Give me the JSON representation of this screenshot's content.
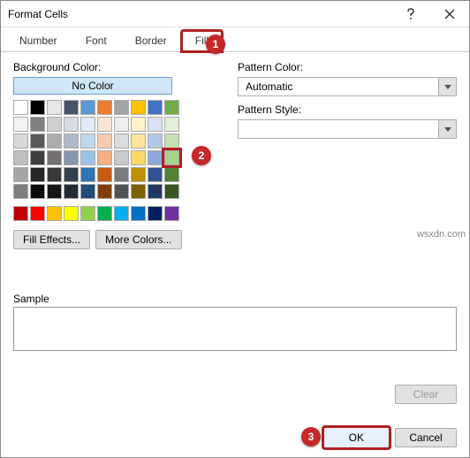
{
  "title": "Format Cells",
  "tabs": {
    "number": "Number",
    "font": "Font",
    "border": "Border",
    "fill": "Fill"
  },
  "left": {
    "bg_label": "Background Color:",
    "no_color": "No Color",
    "fill_effects": "Fill Effects...",
    "more_colors": "More Colors..."
  },
  "right": {
    "pattern_color_label": "Pattern Color:",
    "pattern_color_value": "Automatic",
    "pattern_style_label": "Pattern Style:",
    "pattern_style_value": ""
  },
  "sample_label": "Sample",
  "buttons": {
    "clear": "Clear",
    "ok": "OK",
    "cancel": "Cancel"
  },
  "callouts": {
    "c1": "1",
    "c2": "2",
    "c3": "3"
  },
  "watermark": "wsxdn.com",
  "theme_rows": [
    [
      "#ffffff",
      "#000000",
      "#e7e6e6",
      "#44546a",
      "#5b9bd5",
      "#ed7d31",
      "#a5a5a5",
      "#ffc000",
      "#4472c4",
      "#70ad47"
    ],
    [
      "#f2f2f2",
      "#808080",
      "#d0cece",
      "#d6dce4",
      "#deebf6",
      "#fbe5d5",
      "#ededed",
      "#fff2cc",
      "#d9e2f3",
      "#e2efd9"
    ],
    [
      "#d8d8d8",
      "#595959",
      "#aeabab",
      "#adb9ca",
      "#bdd7ee",
      "#f7cbac",
      "#dbdbdb",
      "#fee599",
      "#b4c6e7",
      "#c5e0b3"
    ],
    [
      "#bfbfbf",
      "#3f3f3f",
      "#757070",
      "#8496b0",
      "#9cc3e5",
      "#f4b183",
      "#c9c9c9",
      "#ffd965",
      "#8eaadb",
      "#a8d08d"
    ],
    [
      "#a5a5a5",
      "#262626",
      "#3a3838",
      "#323f4f",
      "#2e75b5",
      "#c55a11",
      "#7b7b7b",
      "#bf9000",
      "#2f5496",
      "#538135"
    ],
    [
      "#7f7f7f",
      "#0c0c0c",
      "#171616",
      "#222a35",
      "#1e4e79",
      "#833c0b",
      "#525252",
      "#7f6000",
      "#1f3864",
      "#375623"
    ]
  ],
  "standard_row": [
    "#c00000",
    "#ff0000",
    "#ffc000",
    "#ffff00",
    "#92d050",
    "#00b050",
    "#00b0f0",
    "#0070c0",
    "#002060",
    "#7030a0"
  ],
  "selected_theme": {
    "row": 3,
    "col": 9
  }
}
